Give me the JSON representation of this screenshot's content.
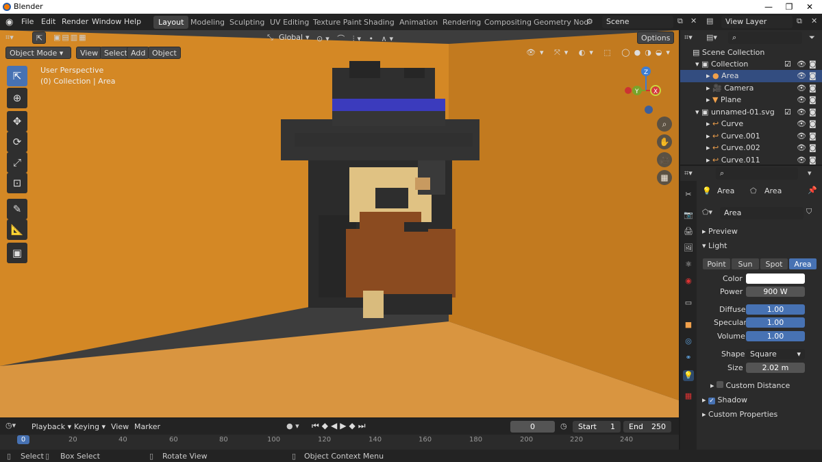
{
  "title": "Blender",
  "menus": [
    "File",
    "Edit",
    "Render",
    "Window",
    "Help"
  ],
  "workspaces": [
    "Layout",
    "Modeling",
    "Sculpting",
    "UV Editing",
    "Texture Paint",
    "Shading",
    "Animation",
    "Rendering",
    "Compositing",
    "Geometry Nod"
  ],
  "scene": "Scene",
  "view_layer": "View Layer",
  "viewport": {
    "mode": "Object Mode",
    "menus": [
      "View",
      "Select",
      "Add",
      "Object"
    ],
    "orientation": "Global",
    "options": "Options",
    "info_line1": "User Perspective",
    "info_line2": "(0) Collection | Area",
    "axes": {
      "z": "Z",
      "y": "Y",
      "x": "X"
    }
  },
  "outliner": {
    "root": "Scene Collection",
    "rows": [
      {
        "label": "Collection",
        "indent": 1,
        "icon": "collection"
      },
      {
        "label": "Area",
        "indent": 2,
        "icon": "light"
      },
      {
        "label": "Camera",
        "indent": 2,
        "icon": "camera"
      },
      {
        "label": "Plane",
        "indent": 2,
        "icon": "mesh"
      },
      {
        "label": "unnamed-01.svg",
        "indent": 1,
        "icon": "collection"
      },
      {
        "label": "Curve",
        "indent": 2,
        "icon": "curve"
      },
      {
        "label": "Curve.001",
        "indent": 2,
        "icon": "curve"
      },
      {
        "label": "Curve.002",
        "indent": 2,
        "icon": "curve"
      },
      {
        "label": "Curve.011",
        "indent": 2,
        "icon": "curve"
      }
    ]
  },
  "properties": {
    "crumb1": "Area",
    "crumb2": "Area",
    "data_name": "Area",
    "preview": "Preview",
    "light": "Light",
    "light_types": [
      "Point",
      "Sun",
      "Spot",
      "Area"
    ],
    "color_label": "Color",
    "color": "#ffffff",
    "power_label": "Power",
    "power": "900 W",
    "diffuse_label": "Diffuse",
    "diffuse": "1.00",
    "specular_label": "Specular",
    "specular": "1.00",
    "volume_label": "Volume",
    "volume": "1.00",
    "shape_label": "Shape",
    "shape": "Square",
    "size_label": "Size",
    "size": "2.02 m",
    "custom_distance": "Custom Distance",
    "shadow": "Shadow",
    "custom_properties": "Custom Properties"
  },
  "timeline": {
    "menus": [
      "Playback",
      "Keying",
      "View",
      "Marker"
    ],
    "current": "0",
    "start_label": "Start",
    "start": "1",
    "end_label": "End",
    "end": "250",
    "ticks": [
      "0",
      "20",
      "40",
      "60",
      "80",
      "100",
      "120",
      "140",
      "160",
      "180",
      "200",
      "220",
      "240"
    ]
  },
  "status": {
    "select": "Select",
    "box_select": "Box Select",
    "rotate": "Rotate View",
    "context": "Object Context Menu"
  },
  "colors": {
    "accent": "#4772b3",
    "wall": "#d98a2a",
    "floor": "#c9862f",
    "hat_band": "#3b3bbd",
    "beard": "#8a4a22"
  }
}
